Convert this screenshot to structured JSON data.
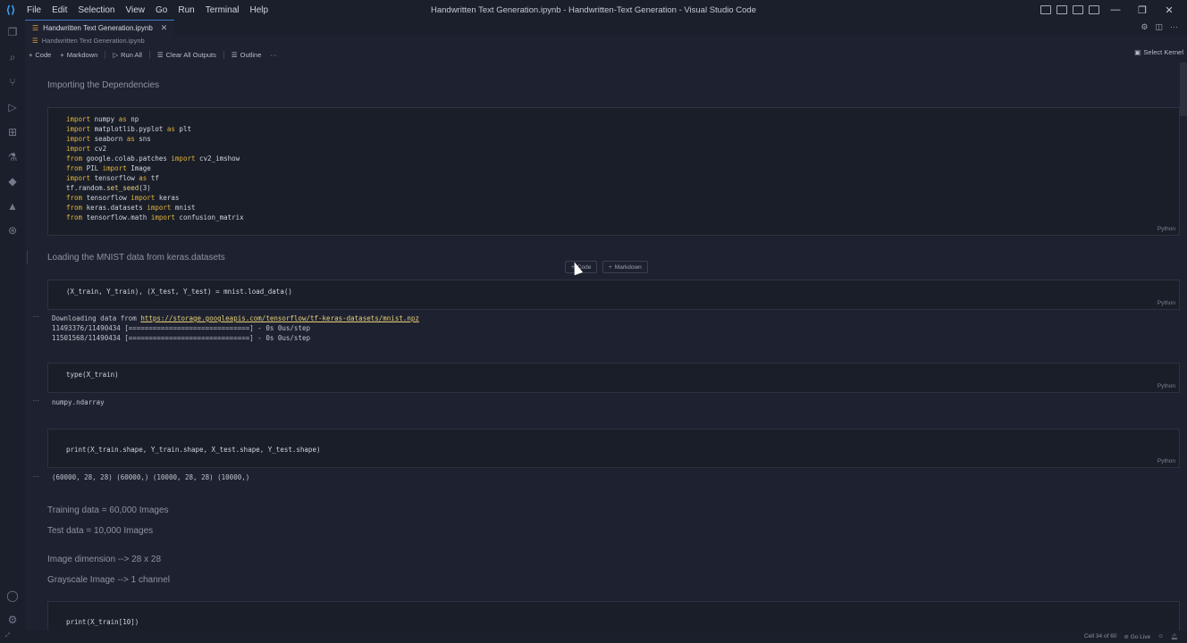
{
  "window": {
    "title": "Handwritten Text Generation.ipynb - Handwritten-Text Generation - Visual Studio Code",
    "menu": [
      "File",
      "Edit",
      "Selection",
      "View",
      "Go",
      "Run",
      "Terminal",
      "Help"
    ],
    "controls": {
      "minimize": "—",
      "restore": "❐",
      "close": "✕"
    }
  },
  "tab": {
    "label": "Handwritten Text Generation.ipynb",
    "close": "✕"
  },
  "breadcrumb": {
    "file": "Handwritten Text Generation.ipynb"
  },
  "toolbar": {
    "code": "Code",
    "markdown": "Markdown",
    "run_all": "Run All",
    "clear_outputs": "Clear All Outputs",
    "outline": "Outline",
    "more": "···",
    "kernel": "Select Kernel"
  },
  "cells": {
    "md1": "Importing the Dependencies",
    "code1_lang": "Python",
    "md2": "Loading the MNIST data from keras.datasets",
    "add_code": "Code",
    "add_markdown": "Markdown",
    "code2": "(X_train, Y_train), (X_test, Y_test) = mnist.load_data()",
    "code2_lang": "Python",
    "out2_prefix": "Downloading data from ",
    "out2_link": "https://storage.googleapis.com/tensorflow/tf-keras-datasets/mnist.npz",
    "out2_line2": "11493376/11490434 [==============================] - 0s 0us/step",
    "out2_line3": "11501568/11490434 [==============================] - 0s 0us/step",
    "code3": "type(X_train)",
    "code3_lang": "Python",
    "out3": "numpy.ndarray",
    "code4": "print(X_train.shape, Y_train.shape, X_test.shape, Y_test.shape)",
    "code4_lang": "Python",
    "out4": "(60000, 28, 28) (60000,) (10000, 28, 28) (10000,)",
    "md3": "Training data = 60,000 Images",
    "md4": "Test data = 10,000 Images",
    "md5": "Image dimension --> 28 x 28",
    "md6": "Grayscale Image --> 1 channel",
    "code5": "print(X_train[10])",
    "output_marker": "···"
  },
  "status": {
    "cell": "Cell 34 of 60",
    "golive": "Go Live"
  }
}
